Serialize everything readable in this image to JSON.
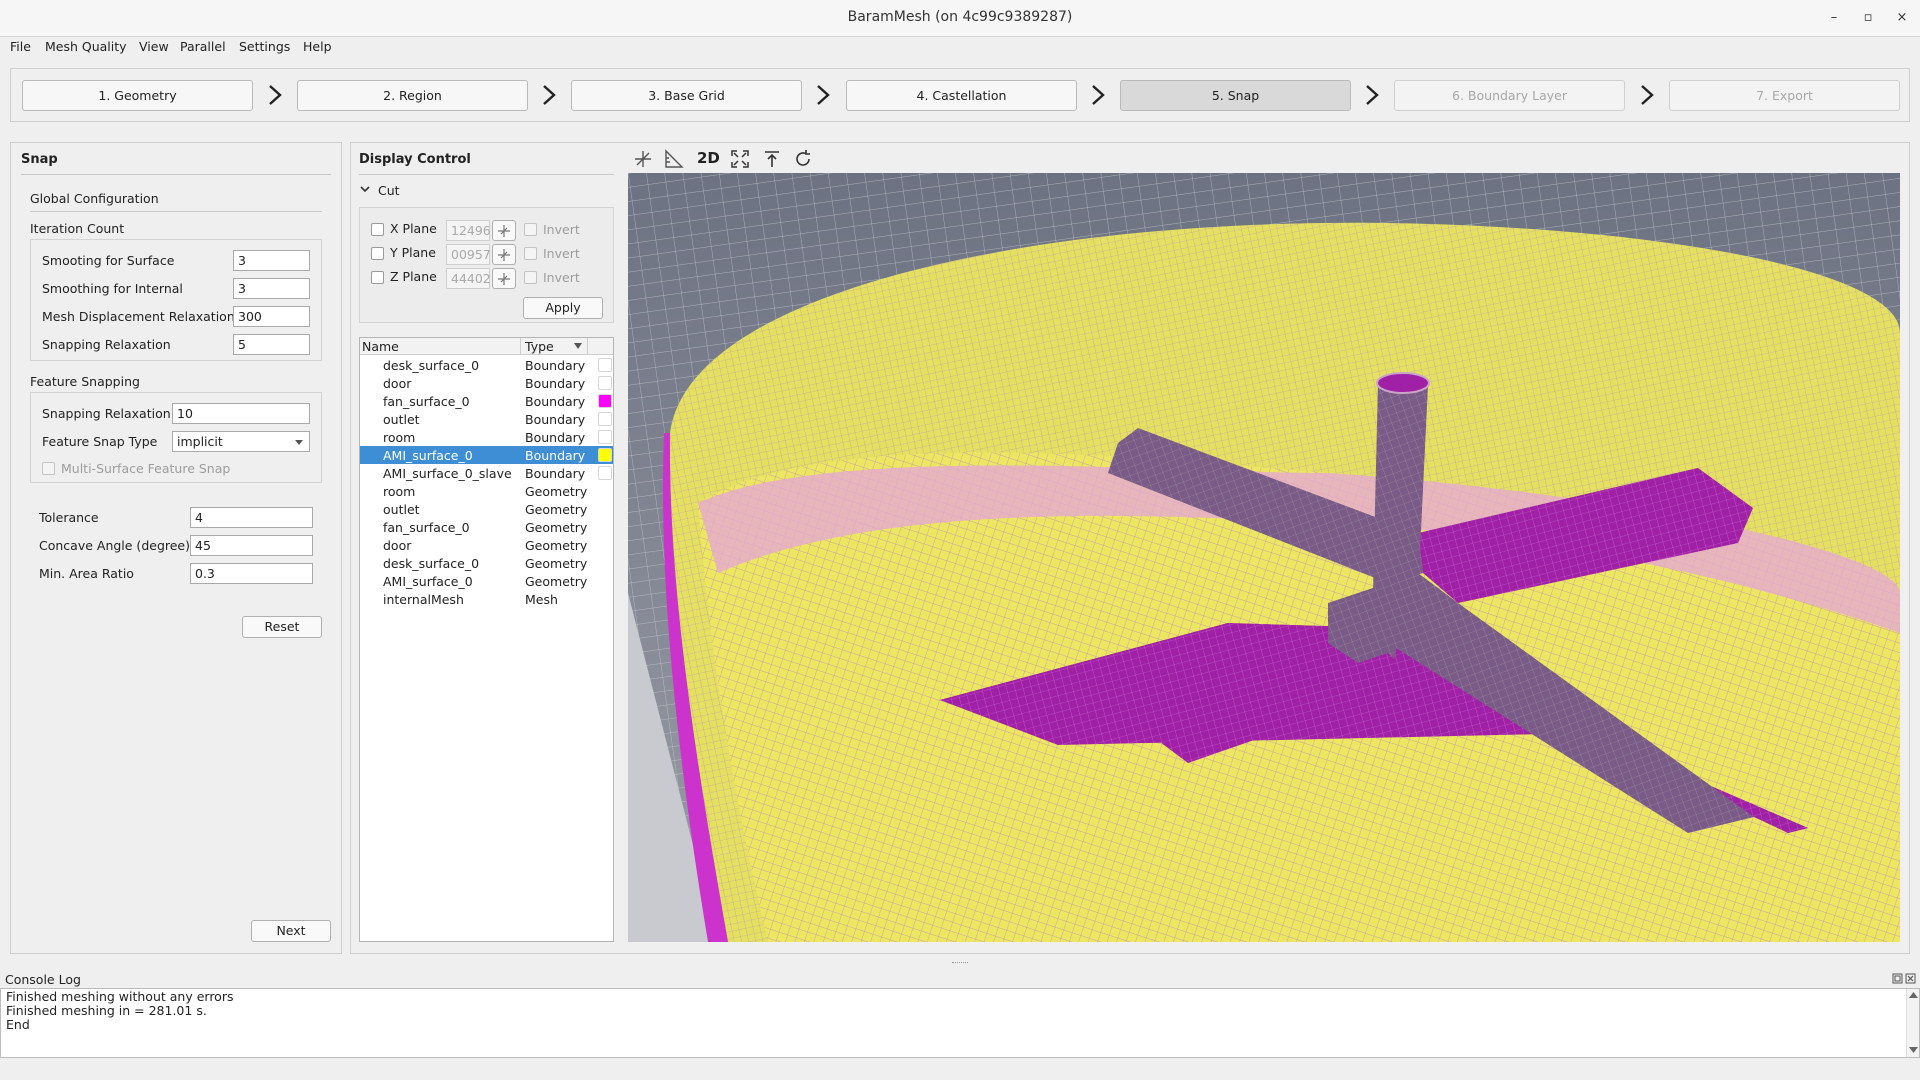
{
  "window": {
    "title": "BaramMesh (on 4c99c9389287)",
    "minimize": "–",
    "maximize": "▫",
    "close": "×"
  },
  "menu": [
    "File",
    "Mesh Quality",
    "View",
    "Parallel",
    "Settings",
    "Help"
  ],
  "steps": [
    {
      "label": "1. Geometry",
      "state": "normal"
    },
    {
      "label": "2. Region",
      "state": "normal"
    },
    {
      "label": "3. Base Grid",
      "state": "normal"
    },
    {
      "label": "4. Castellation",
      "state": "normal"
    },
    {
      "label": "5. Snap",
      "state": "active"
    },
    {
      "label": "6. Boundary Layer",
      "state": "disabled"
    },
    {
      "label": "7. Export",
      "state": "disabled"
    }
  ],
  "snap": {
    "title": "Snap",
    "global_configuration": "Global Configuration",
    "iteration_count": "Iteration Count",
    "smoothing_surface_label": "Smooting for Surface",
    "smoothing_surface_value": "3",
    "smoothing_internal_label": "Smoothing for Internal",
    "smoothing_internal_value": "3",
    "mesh_disp_label": "Mesh Displacement Relaxation",
    "mesh_disp_value": "300",
    "snapping_relax_label": "Snapping Relaxation",
    "snapping_relax_value": "5",
    "feature_snapping": "Feature Snapping",
    "feature_relax_label": "Snapping Relaxation",
    "feature_relax_value": "10",
    "feature_type_label": "Feature Snap Type",
    "feature_type_value": "implicit",
    "multi_surface_label": "Multi-Surface Feature Snap",
    "tolerance_label": "Tolerance",
    "tolerance_value": "4",
    "concave_label": "Concave Angle (degree)",
    "concave_value": "45",
    "min_area_label": "Min. Area Ratio",
    "min_area_value": "0.3",
    "reset": "Reset",
    "next": "Next"
  },
  "display": {
    "title": "Display Control",
    "cut": "Cut",
    "planes": [
      {
        "label": "X Plane",
        "value": "12496",
        "invert": "Invert"
      },
      {
        "label": "Y Plane",
        "value": "00957",
        "invert": "Invert"
      },
      {
        "label": "Z Plane",
        "value": "44402",
        "invert": "Invert"
      }
    ],
    "apply": "Apply",
    "col_name": "Name",
    "col_type": "Type",
    "rows": [
      {
        "name": "desk_surface_0",
        "type": "Boundary",
        "color": "#ffffff"
      },
      {
        "name": "door",
        "type": "Boundary",
        "color": "#ffffff"
      },
      {
        "name": "fan_surface_0",
        "type": "Boundary",
        "color": "#ff00ff"
      },
      {
        "name": "outlet",
        "type": "Boundary",
        "color": "#ffffff"
      },
      {
        "name": "room",
        "type": "Boundary",
        "color": "#ffffff"
      },
      {
        "name": "AMI_surface_0",
        "type": "Boundary",
        "color": "#ffff00",
        "selected": true
      },
      {
        "name": "AMI_surface_0_slave",
        "type": "Boundary",
        "color": "#ffffff"
      },
      {
        "name": "room",
        "type": "Geometry"
      },
      {
        "name": "outlet",
        "type": "Geometry"
      },
      {
        "name": "fan_surface_0",
        "type": "Geometry"
      },
      {
        "name": "door",
        "type": "Geometry"
      },
      {
        "name": "desk_surface_0",
        "type": "Geometry"
      },
      {
        "name": "AMI_surface_0",
        "type": "Geometry"
      },
      {
        "name": "internalMesh",
        "type": "Mesh"
      }
    ]
  },
  "view_tools": {
    "mode_2d": "2D"
  },
  "console": {
    "title": "Console Log",
    "lines": [
      "Finished meshing without any errors",
      "Finished meshing in = 281.01 s.",
      "End"
    ]
  }
}
